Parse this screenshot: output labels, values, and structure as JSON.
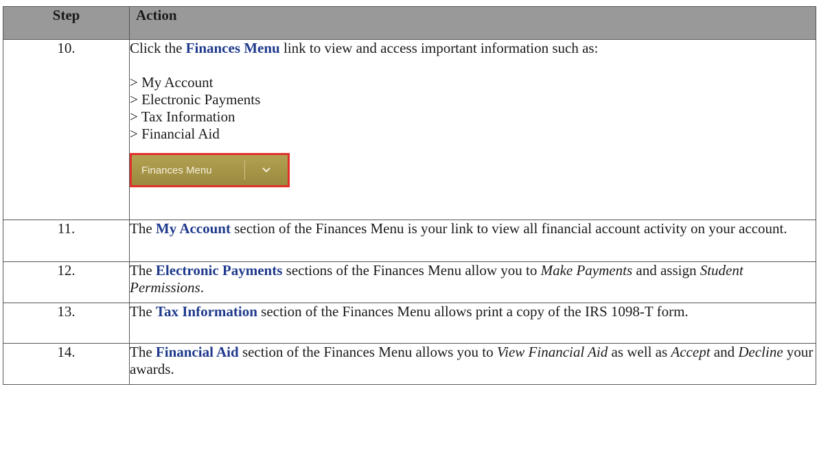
{
  "table": {
    "headers": {
      "step": "Step",
      "action": "Action"
    },
    "rows": [
      {
        "step": "10.",
        "pre": "Click the ",
        "kw": "Finances Menu",
        "post": " link to view and access important information such as:",
        "list": [
          "> My Account",
          "> Electronic Payments",
          "> Tax Information",
          "> Financial Aid"
        ],
        "button_label": "Finances Menu"
      },
      {
        "step": "11.",
        "pre": "The ",
        "kw": "My Account",
        "post": " section of the Finances Menu is your link to view all financial account activity on your account."
      },
      {
        "step": "12.",
        "pre": "The ",
        "kw": "Electronic Payments",
        "mid1": " sections of the Finances Menu allow you to ",
        "it1": "Make Payments",
        "mid2": " and assign ",
        "it2": "Student Permissions",
        "end": "."
      },
      {
        "step": "13.",
        "pre": "The ",
        "kw": "Tax Information",
        "post": " section of the Finances Menu allows print a copy of the IRS 1098-T form."
      },
      {
        "step": "14.",
        "pre": "The ",
        "kw": "Financial Aid",
        "mid1": " section of the Finances Menu allows you to ",
        "it1": "View Financial Aid",
        "mid2": " as well as ",
        "it2": "Accept",
        "mid3": " and ",
        "it3": "Decline",
        "end": " your awards."
      }
    ]
  },
  "colors": {
    "header_bg": "#999999",
    "keyword": "#1f3a8c",
    "button_bg": "#a8974a",
    "button_border": "#e0302b"
  }
}
